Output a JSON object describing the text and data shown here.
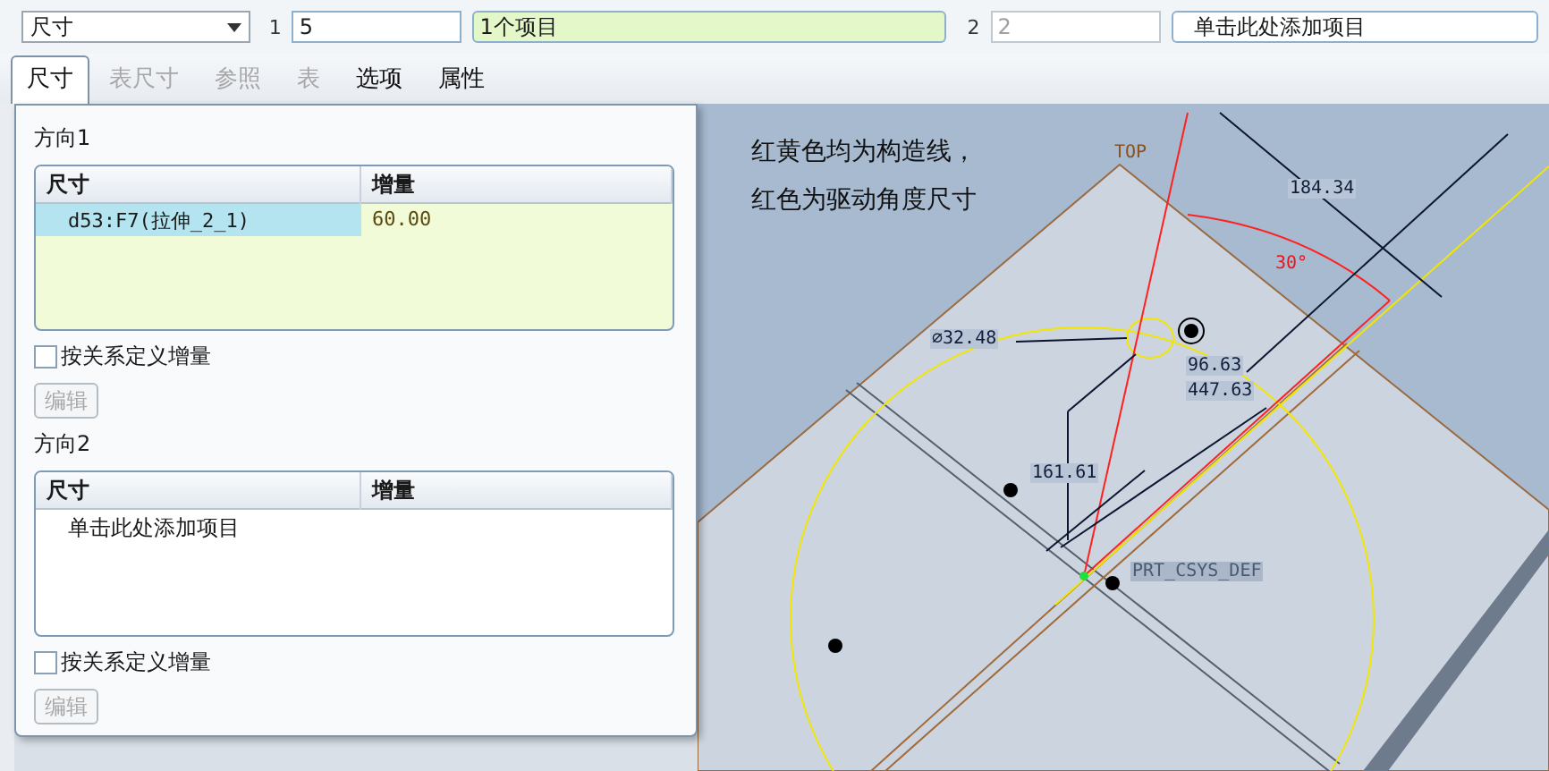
{
  "toolbar": {
    "type_dropdown": "尺寸",
    "directions": [
      {
        "label": "1",
        "count": "5",
        "count_disabled": false,
        "items": "1个项目",
        "active": true
      },
      {
        "label": "2",
        "count": "2",
        "count_disabled": true,
        "items": "单击此处添加项目",
        "active": false
      }
    ]
  },
  "tabs": [
    {
      "label": "尺寸",
      "selected": true,
      "disabled": false
    },
    {
      "label": "表尺寸",
      "selected": false,
      "disabled": true
    },
    {
      "label": "参照",
      "selected": false,
      "disabled": true
    },
    {
      "label": "表",
      "selected": false,
      "disabled": true
    },
    {
      "label": "选项",
      "selected": false,
      "disabled": false
    },
    {
      "label": "属性",
      "selected": false,
      "disabled": false
    }
  ],
  "sections": [
    {
      "title": "方向1",
      "active": true,
      "columns": [
        "尺寸",
        "增量"
      ],
      "rows": [
        {
          "kind": "item",
          "cells": [
            "d53:F7(拉伸_2_1)",
            "60.00"
          ],
          "selected": true
        }
      ],
      "checkbox": {
        "label": "按关系定义增量",
        "checked": false
      },
      "button": {
        "label": "编辑",
        "disabled": true
      }
    },
    {
      "title": "方向2",
      "active": false,
      "columns": [
        "尺寸",
        "增量"
      ],
      "rows": [
        {
          "kind": "add",
          "cells": [
            "单击此处添加项目"
          ],
          "selected": false
        }
      ],
      "checkbox": {
        "label": "按关系定义增量",
        "checked": false
      },
      "button": {
        "label": "编辑",
        "disabled": true
      }
    }
  ],
  "canvas": {
    "notes": [
      "红黄色均为构造线，",
      "红色为驱动角度尺寸"
    ],
    "labels": [
      {
        "text": "TOP",
        "kind": "datum"
      },
      {
        "text": "184.34",
        "kind": "linear"
      },
      {
        "text": "30°",
        "kind": "angle"
      },
      {
        "text": "⌀32.48",
        "kind": "linear"
      },
      {
        "text": "96.63",
        "kind": "linear"
      },
      {
        "text": "447.63",
        "kind": "linear"
      },
      {
        "text": "161.61",
        "kind": "linear"
      },
      {
        "text": "PRT_CSYS_DEF",
        "kind": "csys"
      }
    ]
  }
}
